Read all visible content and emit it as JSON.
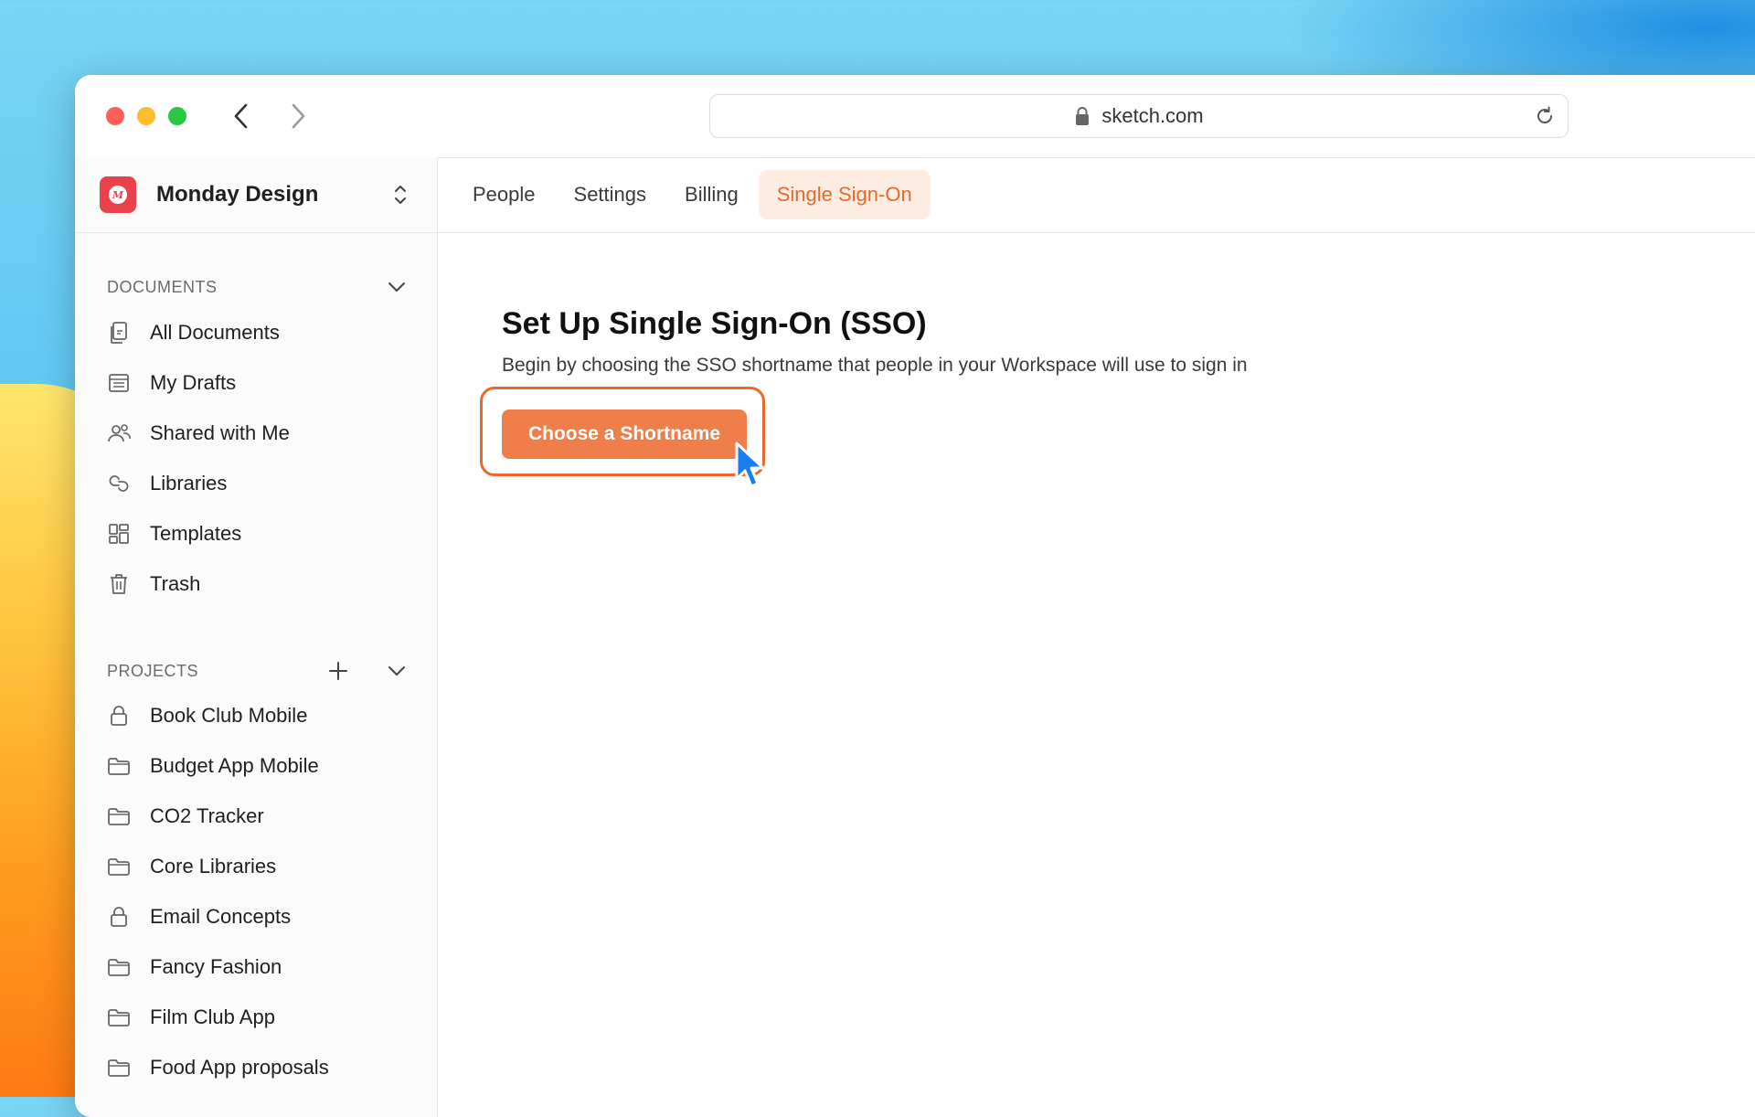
{
  "browser": {
    "url": "sketch.com"
  },
  "workspace": {
    "name": "Monday Design",
    "logo_letter": "M"
  },
  "sidebar": {
    "documents_heading": "DOCUMENTS",
    "documents": [
      {
        "label": "All Documents",
        "icon": "documents-icon"
      },
      {
        "label": "My Drafts",
        "icon": "drafts-icon"
      },
      {
        "label": "Shared with Me",
        "icon": "people-icon"
      },
      {
        "label": "Libraries",
        "icon": "libraries-icon"
      },
      {
        "label": "Templates",
        "icon": "templates-icon"
      },
      {
        "label": "Trash",
        "icon": "trash-icon"
      }
    ],
    "projects_heading": "PROJECTS",
    "projects": [
      {
        "label": "Book Club Mobile",
        "icon": "lock-icon"
      },
      {
        "label": "Budget App Mobile",
        "icon": "folder-icon"
      },
      {
        "label": "CO2 Tracker",
        "icon": "folder-icon"
      },
      {
        "label": "Core Libraries",
        "icon": "folder-icon"
      },
      {
        "label": "Email Concepts",
        "icon": "lock-icon"
      },
      {
        "label": "Fancy Fashion",
        "icon": "folder-icon"
      },
      {
        "label": "Film Club App",
        "icon": "folder-icon"
      },
      {
        "label": "Food App proposals",
        "icon": "folder-icon"
      }
    ]
  },
  "tabs": [
    {
      "label": "People",
      "active": false
    },
    {
      "label": "Settings",
      "active": false
    },
    {
      "label": "Billing",
      "active": false
    },
    {
      "label": "Single Sign-On",
      "active": true
    }
  ],
  "main": {
    "title": "Set Up Single Sign-On (SSO)",
    "subtitle": "Begin by choosing the SSO shortname that people in your Workspace will use to sign in",
    "cta_label": "Choose a Shortname"
  },
  "colors": {
    "accent": "#e9692c",
    "button": "#f07e4a",
    "active_tab_bg": "#fdece2",
    "cursor": "#1a7cf0"
  }
}
